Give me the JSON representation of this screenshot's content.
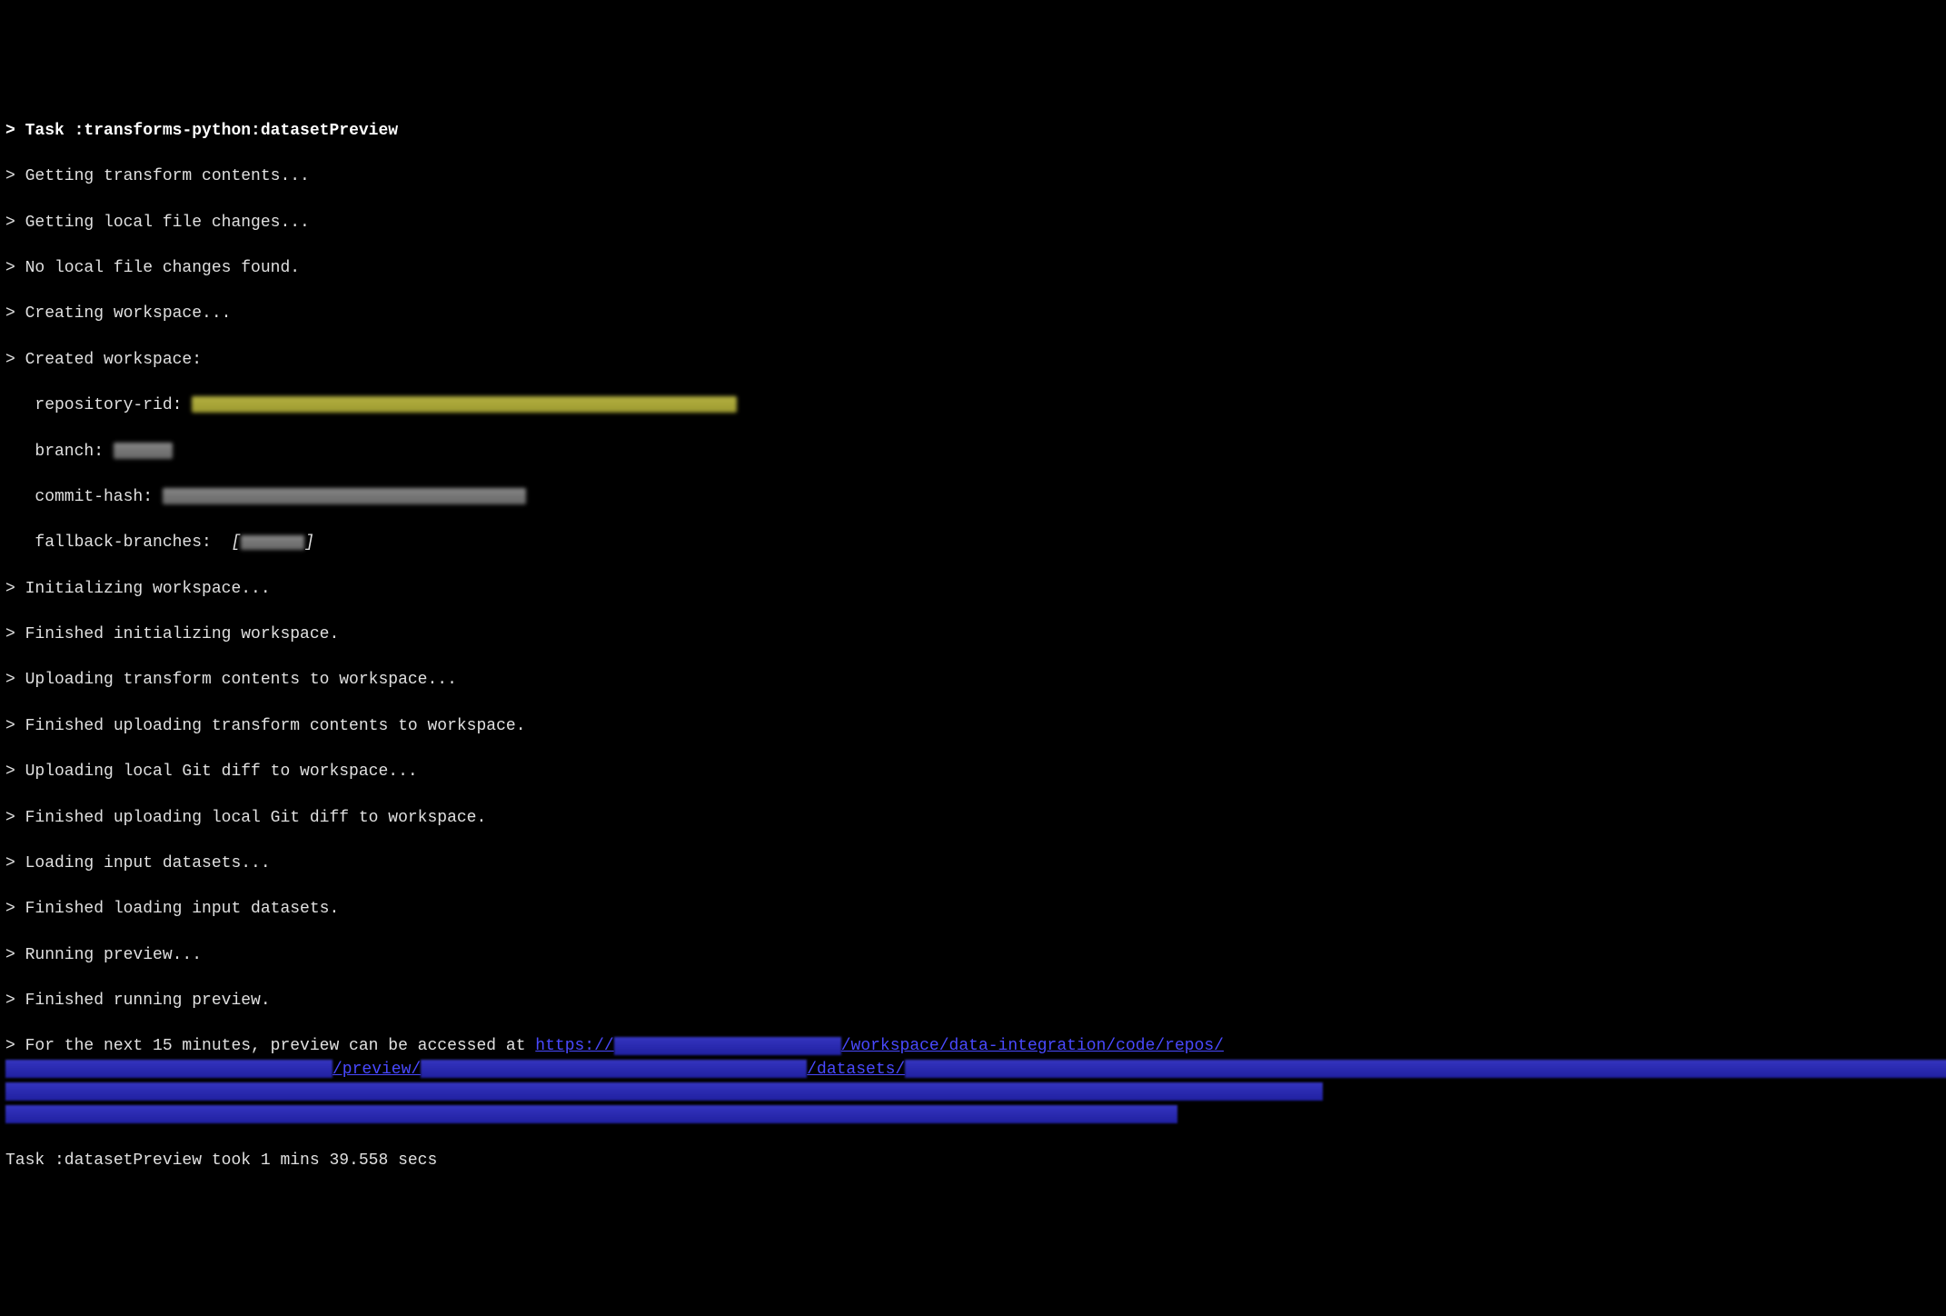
{
  "terminal": {
    "header_prompt": "> ",
    "header_text": "Task :transforms-python:datasetPreview",
    "lines": {
      "l1": "> Getting transform contents...",
      "l2": "> Getting local file changes...",
      "l3": "> No local file changes found.",
      "l4": "> Creating workspace...",
      "l5": "> Created workspace:",
      "l6_label": "repository-rid: ",
      "l7_label": "branch: ",
      "l8_label": "commit-hash: ",
      "l9_label": "fallback-branches: ",
      "l9_bracket_open": "[",
      "l9_bracket_close": "]",
      "l10": "> Initializing workspace...",
      "l11": "> Finished initializing workspace.",
      "l12": "> Uploading transform contents to workspace...",
      "l13": "> Finished uploading transform contents to workspace.",
      "l14": "> Uploading local Git diff to workspace...",
      "l15": "> Finished uploading local Git diff to workspace.",
      "l16": "> Loading input datasets...",
      "l17": "> Finished loading input datasets.",
      "l18": "> Running preview...",
      "l19": "> Finished running preview.",
      "l20_prefix": "> For the next 15 minutes, preview can be accessed at ",
      "url_https": "https://",
      "url_seg1": "/workspace/data-integration/code/repos/",
      "url_seg2": "/preview/",
      "url_seg3": "/datasets/",
      "footer": "Task :datasetPreview took 1 mins 39.558 secs"
    }
  }
}
